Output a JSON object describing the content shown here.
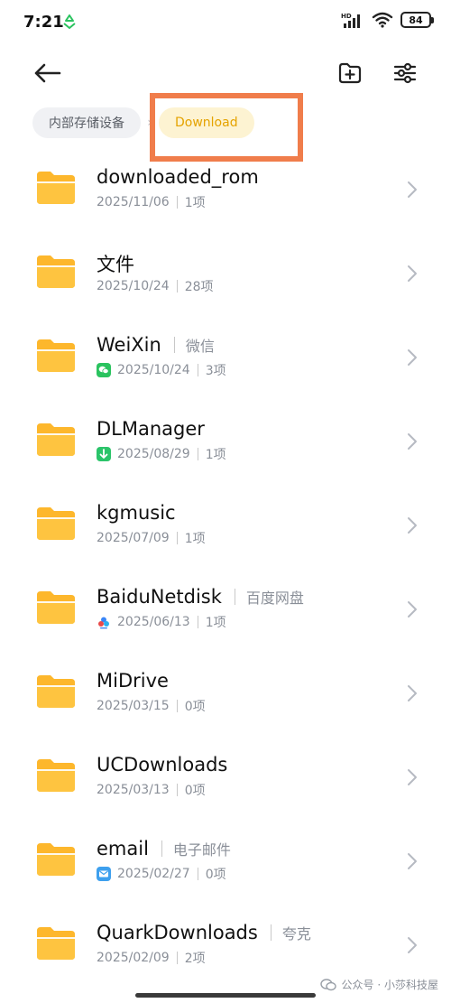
{
  "status_bar": {
    "time": "7:21",
    "network": "HD",
    "battery": "84"
  },
  "icons": {
    "back": "arrow-left-icon",
    "new_folder": "folder-plus-icon",
    "filter": "sliders-icon",
    "folder": "folder-icon",
    "chevron": "chevron-right-icon"
  },
  "breadcrumb": {
    "storage_label": "内部存储设备",
    "current_label": "Download"
  },
  "colors": {
    "folder": "#fdb72c",
    "highlight_box": "#f07d4b",
    "crumb_current_text": "#e5a300",
    "wechat": "#2ac35f",
    "dlmanager": "#2bc46a",
    "email": "#3ea0ee"
  },
  "files": [
    {
      "name": "downloaded_rom",
      "date": "2025/11/06",
      "count": "1项"
    },
    {
      "name": "文件",
      "date": "2025/10/24",
      "count": "28项"
    },
    {
      "name": "WeiXin",
      "tag": "微信",
      "date": "2025/10/24",
      "count": "3项",
      "badge": "wechat-icon"
    },
    {
      "name": "DLManager",
      "date": "2025/08/29",
      "count": "1项",
      "badge": "download-arrow-icon"
    },
    {
      "name": "kgmusic",
      "date": "2025/07/09",
      "count": "1项"
    },
    {
      "name": "BaiduNetdisk",
      "tag": "百度网盘",
      "date": "2025/06/13",
      "count": "1项",
      "badge": "baidu-cloud-icon"
    },
    {
      "name": "MiDrive",
      "date": "2025/03/15",
      "count": "0项"
    },
    {
      "name": "UCDownloads",
      "date": "2025/03/13",
      "count": "0项"
    },
    {
      "name": "email",
      "tag": "电子邮件",
      "date": "2025/02/27",
      "count": "0项",
      "badge": "mail-icon"
    },
    {
      "name": "QuarkDownloads",
      "tag": "夸克",
      "date": "2025/02/09",
      "count": "2项"
    }
  ],
  "watermark": "公众号 · 小莎科技屋"
}
